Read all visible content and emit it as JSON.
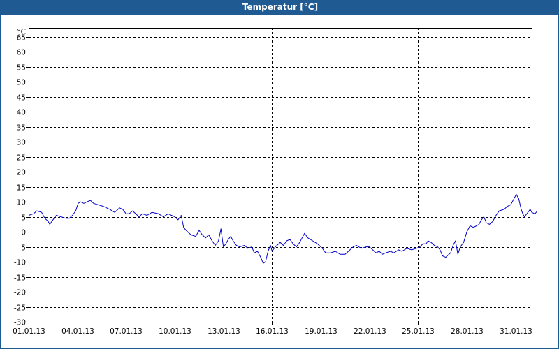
{
  "window": {
    "title": "Temperatur [°C]"
  },
  "colors": {
    "titlebar": "#1f5b92",
    "series": "#0000c8",
    "grid": "#000000"
  },
  "chart_data": {
    "type": "line",
    "title": "Temperatur [°C]",
    "ylabel": "°C",
    "xlabel": "",
    "ylim": [
      -30,
      68
    ],
    "xlim": [
      0,
      31
    ],
    "y_ticks": [
      65,
      60,
      55,
      50,
      45,
      40,
      35,
      30,
      25,
      20,
      15,
      10,
      5,
      0,
      -5,
      -10,
      -15,
      -20,
      -25,
      -30
    ],
    "x_ticks": [
      {
        "x": 0,
        "label": "01.01.13"
      },
      {
        "x": 3,
        "label": "04.01.13"
      },
      {
        "x": 6,
        "label": "07.01.13"
      },
      {
        "x": 9,
        "label": "10.01.13"
      },
      {
        "x": 12,
        "label": "13.01.13"
      },
      {
        "x": 15,
        "label": "16.01.13"
      },
      {
        "x": 18,
        "label": "19.01.13"
      },
      {
        "x": 21,
        "label": "22.01.13"
      },
      {
        "x": 24,
        "label": "25.01.13"
      },
      {
        "x": 27,
        "label": "28.01.13"
      },
      {
        "x": 30,
        "label": "31.01.13"
      }
    ],
    "x_unit": "days since 01.01.13",
    "grid": true,
    "series": [
      {
        "name": "Temperatur",
        "points": [
          [
            0.0,
            5.5
          ],
          [
            0.3,
            6.0
          ],
          [
            0.5,
            7.0
          ],
          [
            0.8,
            6.5
          ],
          [
            1.0,
            4.5
          ],
          [
            1.2,
            3.5
          ],
          [
            1.3,
            2.5
          ],
          [
            1.5,
            4.0
          ],
          [
            1.7,
            5.5
          ],
          [
            2.0,
            5.0
          ],
          [
            2.3,
            4.5
          ],
          [
            2.5,
            4.5
          ],
          [
            2.7,
            5.5
          ],
          [
            2.9,
            7.0
          ],
          [
            3.05,
            9.5
          ],
          [
            3.2,
            10.0
          ],
          [
            3.4,
            9.5
          ],
          [
            3.6,
            10.0
          ],
          [
            3.8,
            10.5
          ],
          [
            4.0,
            9.5
          ],
          [
            4.3,
            9.0
          ],
          [
            4.6,
            8.5
          ],
          [
            5.0,
            7.5
          ],
          [
            5.3,
            6.5
          ],
          [
            5.6,
            8.0
          ],
          [
            5.8,
            7.5
          ],
          [
            6.0,
            6.0
          ],
          [
            6.2,
            6.0
          ],
          [
            6.4,
            7.0
          ],
          [
            6.6,
            6.0
          ],
          [
            6.8,
            5.0
          ],
          [
            7.0,
            6.0
          ],
          [
            7.3,
            5.5
          ],
          [
            7.6,
            6.5
          ],
          [
            8.0,
            6.0
          ],
          [
            8.3,
            5.0
          ],
          [
            8.6,
            6.0
          ],
          [
            8.8,
            5.5
          ],
          [
            9.0,
            5.0
          ],
          [
            9.2,
            4.0
          ],
          [
            9.4,
            5.5
          ],
          [
            9.55,
            1.5
          ],
          [
            9.7,
            0.5
          ],
          [
            10.0,
            -1.0
          ],
          [
            10.3,
            -1.5
          ],
          [
            10.5,
            0.5
          ],
          [
            10.7,
            -1.0
          ],
          [
            10.9,
            -2.0
          ],
          [
            11.1,
            -1.0
          ],
          [
            11.3,
            -3.0
          ],
          [
            11.5,
            -4.5
          ],
          [
            11.7,
            -3.0
          ],
          [
            11.85,
            1.0
          ],
          [
            12.0,
            -5.0
          ],
          [
            12.15,
            -4.0
          ],
          [
            12.3,
            -2.5
          ],
          [
            12.45,
            -1.5
          ],
          [
            12.6,
            -3.0
          ],
          [
            12.8,
            -4.5
          ],
          [
            13.0,
            -5.0
          ],
          [
            13.3,
            -4.5
          ],
          [
            13.5,
            -5.5
          ],
          [
            13.75,
            -5.0
          ],
          [
            13.9,
            -7.0
          ],
          [
            14.1,
            -6.5
          ],
          [
            14.3,
            -8.5
          ],
          [
            14.45,
            -10.5
          ],
          [
            14.6,
            -10.0
          ],
          [
            14.75,
            -6.5
          ],
          [
            14.9,
            -4.5
          ],
          [
            15.0,
            -6.5
          ],
          [
            15.2,
            -5.0
          ],
          [
            15.5,
            -3.5
          ],
          [
            15.7,
            -4.5
          ],
          [
            15.9,
            -3.0
          ],
          [
            16.1,
            -2.5
          ],
          [
            16.3,
            -4.0
          ],
          [
            16.5,
            -5.0
          ],
          [
            16.7,
            -3.5
          ],
          [
            17.0,
            -0.5
          ],
          [
            17.2,
            -2.0
          ],
          [
            17.5,
            -3.0
          ],
          [
            17.8,
            -4.0
          ],
          [
            18.1,
            -5.5
          ],
          [
            18.3,
            -7.0
          ],
          [
            18.6,
            -7.0
          ],
          [
            18.9,
            -6.5
          ],
          [
            19.2,
            -7.5
          ],
          [
            19.5,
            -7.5
          ],
          [
            19.8,
            -6.0
          ],
          [
            20.0,
            -5.0
          ],
          [
            20.2,
            -4.5
          ],
          [
            20.5,
            -5.5
          ],
          [
            20.8,
            -5.0
          ],
          [
            21.0,
            -5.0
          ],
          [
            21.2,
            -6.0
          ],
          [
            21.4,
            -7.0
          ],
          [
            21.6,
            -6.5
          ],
          [
            21.8,
            -7.5
          ],
          [
            22.0,
            -7.0
          ],
          [
            22.3,
            -6.5
          ],
          [
            22.5,
            -7.0
          ],
          [
            22.8,
            -6.0
          ],
          [
            23.0,
            -6.5
          ],
          [
            23.3,
            -5.5
          ],
          [
            23.6,
            -6.0
          ],
          [
            23.9,
            -5.5
          ],
          [
            24.1,
            -5.0
          ],
          [
            24.3,
            -4.0
          ],
          [
            24.5,
            -4.0
          ],
          [
            24.6,
            -3.0
          ],
          [
            24.8,
            -3.5
          ],
          [
            25.0,
            -4.5
          ],
          [
            25.2,
            -5.0
          ],
          [
            25.35,
            -6.0
          ],
          [
            25.5,
            -8.0
          ],
          [
            25.7,
            -8.5
          ],
          [
            25.9,
            -7.5
          ],
          [
            26.0,
            -7.0
          ],
          [
            26.15,
            -4.5
          ],
          [
            26.3,
            -3.0
          ],
          [
            26.45,
            -7.5
          ],
          [
            26.6,
            -5.0
          ],
          [
            26.8,
            -3.5
          ],
          [
            27.0,
            0.0
          ],
          [
            27.2,
            2.0
          ],
          [
            27.4,
            1.5
          ],
          [
            27.6,
            2.0
          ],
          [
            27.75,
            2.5
          ],
          [
            27.9,
            4.0
          ],
          [
            28.05,
            5.0
          ],
          [
            28.2,
            3.0
          ],
          [
            28.4,
            2.5
          ],
          [
            28.6,
            3.5
          ],
          [
            28.8,
            5.5
          ],
          [
            29.0,
            7.0
          ],
          [
            29.3,
            7.5
          ],
          [
            29.5,
            8.5
          ],
          [
            29.7,
            9.0
          ],
          [
            29.9,
            11.0
          ],
          [
            30.05,
            12.5
          ],
          [
            30.2,
            11.0
          ],
          [
            30.35,
            7.5
          ],
          [
            30.45,
            6.0
          ],
          [
            30.55,
            5.0
          ],
          [
            30.7,
            6.0
          ],
          [
            30.9,
            7.5
          ],
          [
            31.0,
            6.5
          ],
          [
            31.2,
            6.0
          ],
          [
            31.35,
            7.0
          ]
        ]
      }
    ]
  }
}
